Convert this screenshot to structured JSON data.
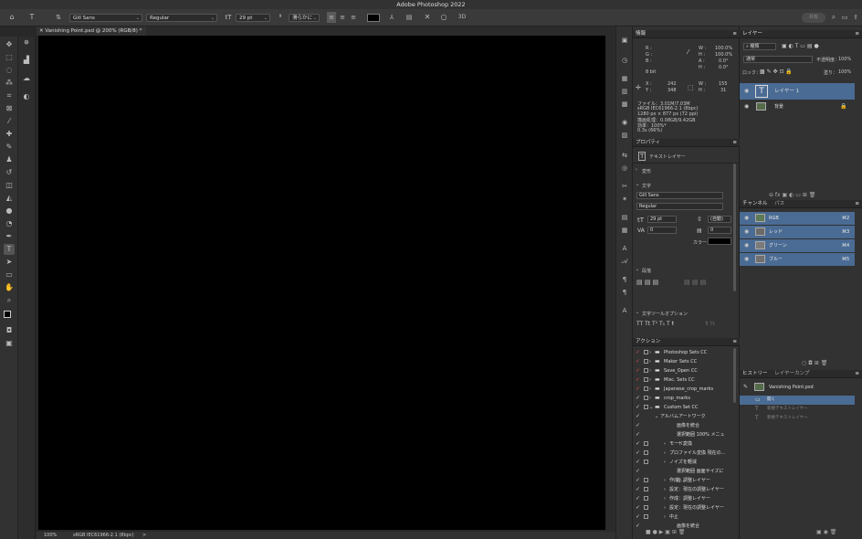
{
  "app_title": "Adobe Photoshop 2022",
  "options": {
    "font_family": "Gill Sans",
    "font_style": "Regular",
    "font_size": "29 pt",
    "antialias": "滑らかに",
    "share_label": "共有"
  },
  "doc_tab": "Vanishing Point.psd @ 200% (RGB/8) *",
  "status": {
    "zoom": "100%",
    "profile": "sRGB IEC61966-2.1 (8bpc)",
    "arrow": ">"
  },
  "info": {
    "title": "情報",
    "r": "R :",
    "g": "G :",
    "b": "B :",
    "bit": "8 bit",
    "w1": "W :",
    "h1": "H :",
    "a": "A :",
    "h2": "H :",
    "w1v": "100.0%",
    "h1v": "100.0%",
    "av": "0.0°",
    "h2v": "0.0°",
    "x": "X :",
    "y": "Y :",
    "xv": "242",
    "yv": "348",
    "w": "W :",
    "h": "H :",
    "wv": "155",
    "hv": "31",
    "file_lines": [
      "ファイル：3.01M/7.03M",
      "sRGB IEC61966-2.1 (8bpc)",
      "1280 px × 877 px (72 ppi)",
      "描画処理：0.08GB/9.42GB",
      "効率：100%*",
      "0.3s (66%)"
    ]
  },
  "properties": {
    "title": "プロパティ",
    "layer_type": "テキストレイヤー",
    "transform": "変形",
    "char_section": "文字",
    "font_family": "Gill Sans",
    "font_style": "Regular",
    "size": "29 pt",
    "leading": "(自動)",
    "kerning": "0",
    "tracking": "0",
    "color_label": "カラー：",
    "paragraph": "段落",
    "text_options": "文字ツールオプション"
  },
  "actions": {
    "title": "アクション",
    "items": [
      {
        "label": "Photoshop Sets CC",
        "indent": 1,
        "red": true
      },
      {
        "label": "Maker Sets CC",
        "indent": 1,
        "red": true
      },
      {
        "label": "Save_Open CC",
        "indent": 1,
        "red": true
      },
      {
        "label": "Misc. Sets CC",
        "indent": 1,
        "red": true
      },
      {
        "label": "Japanese_crop_marks",
        "indent": 1,
        "red": true
      },
      {
        "label": "crop_marks",
        "indent": 1,
        "red": false
      },
      {
        "label": "Custom Set CC",
        "indent": 1,
        "red": false
      },
      {
        "label": "アルバムアートワーク",
        "indent": 2,
        "red": false
      },
      {
        "label": "画像を統合",
        "indent": 4,
        "red": false
      },
      {
        "label": "選択範囲 100% メニュー...",
        "indent": 4,
        "red": false
      },
      {
        "label": "モード変換",
        "indent": 3,
        "red": false
      },
      {
        "label": "プロファイル変換 現在の...",
        "indent": 3,
        "red": false
      },
      {
        "label": "ノイズを軽減",
        "indent": 3,
        "red": false
      },
      {
        "label": "選択範囲 画面サイズに合...",
        "indent": 4,
        "red": false
      },
      {
        "label": "作成：調整レイヤー",
        "indent": 3,
        "red": false
      },
      {
        "label": "設定：現在の調整レイヤー",
        "indent": 3,
        "red": false
      },
      {
        "label": "作成：調整レイヤー",
        "indent": 3,
        "red": false
      },
      {
        "label": "設定：現在の調整レイヤー",
        "indent": 3,
        "red": false
      },
      {
        "label": "中止",
        "indent": 3,
        "red": false
      },
      {
        "label": "画像を統合",
        "indent": 4,
        "red": false
      }
    ]
  },
  "layers": {
    "title": "レイヤー",
    "search": "種類",
    "blend": "通常",
    "opacity_label": "不透明度：",
    "opacity": "100%",
    "lock_label": "ロック：",
    "fill_label": "塗り：",
    "fill": "100%",
    "items": [
      {
        "name": "レイヤー 1",
        "selected": true
      },
      {
        "name": "背景",
        "selected": false
      }
    ]
  },
  "channels": {
    "tab1": "チャンネル",
    "tab2": "パス",
    "items": [
      {
        "name": "RGB",
        "key": "⌘2"
      },
      {
        "name": "レッド",
        "key": "⌘3"
      },
      {
        "name": "グリーン",
        "key": "⌘4"
      },
      {
        "name": "ブルー",
        "key": "⌘5"
      }
    ]
  },
  "history": {
    "tab1": "ヒストリー",
    "tab2": "レイヤーカンプ",
    "snapshot": "Vanishing Point.psd",
    "items": [
      "開く",
      "新規テキストレイヤー",
      "新規テキストレイヤー"
    ]
  }
}
